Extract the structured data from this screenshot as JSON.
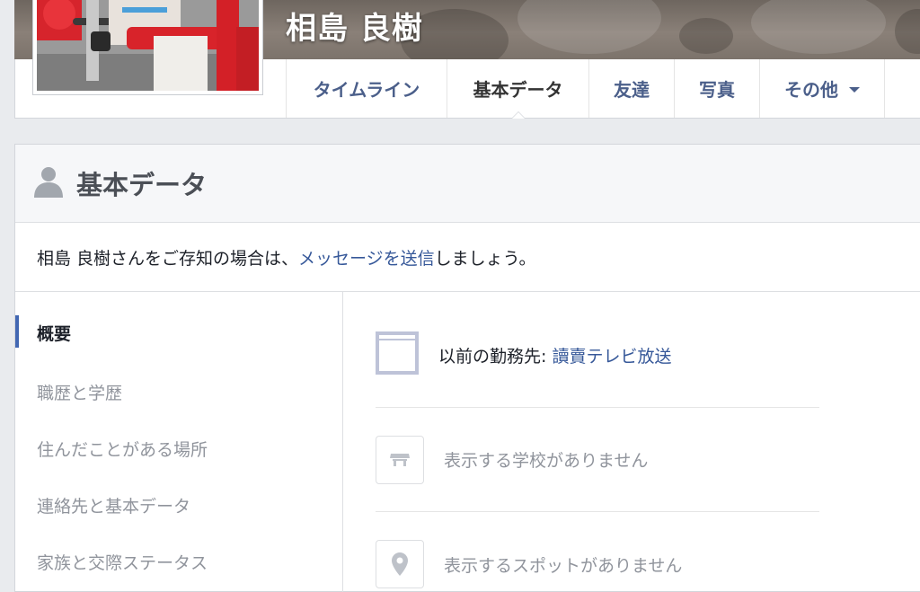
{
  "profile": {
    "name": "相島 良樹"
  },
  "nav": {
    "tabs": [
      {
        "label": "タイムライン"
      },
      {
        "label": "基本データ"
      },
      {
        "label": "友達"
      },
      {
        "label": "写真"
      },
      {
        "label": "その他"
      }
    ]
  },
  "about": {
    "title": "基本データ",
    "message_prefix": "相島 良樹さんをご存知の場合は、",
    "message_link": "メッセージを送信",
    "message_suffix": "しましょう。",
    "sidebar": [
      {
        "label": "概要"
      },
      {
        "label": "職歴と学歴"
      },
      {
        "label": "住んだことがある場所"
      },
      {
        "label": "連絡先と基本データ"
      },
      {
        "label": "家族と交際ステータス"
      }
    ],
    "overview": {
      "work_prefix": "以前の勤務先: ",
      "work_link": "讀賣テレビ放送",
      "school_text": "表示する学校がありません",
      "place_text": "表示するスポットがありません"
    }
  }
}
